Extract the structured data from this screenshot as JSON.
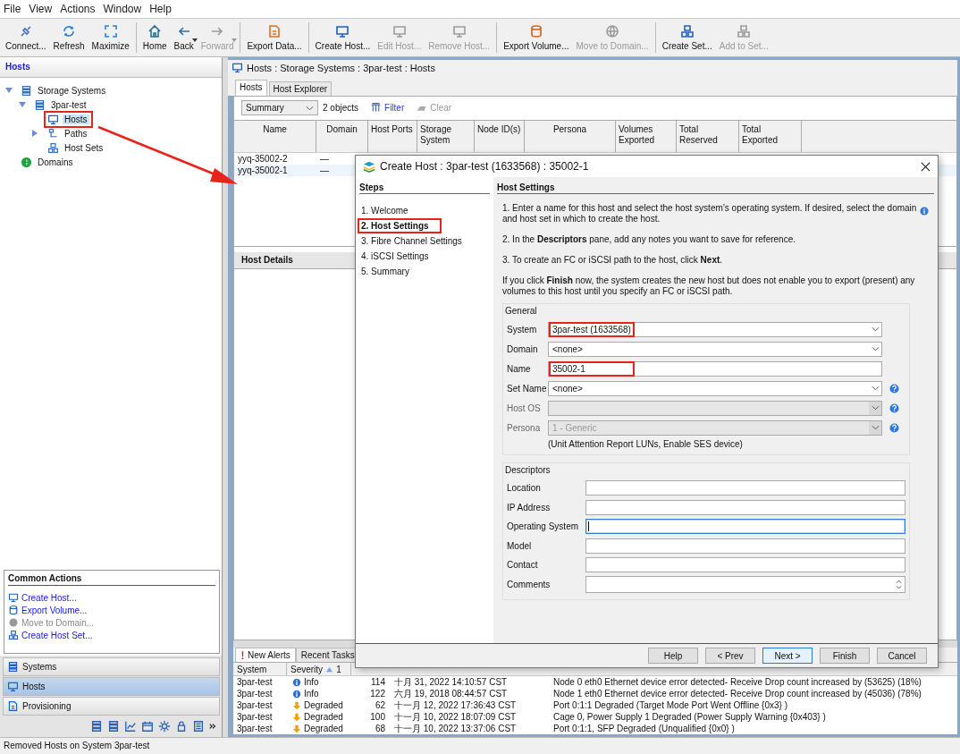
{
  "menu": [
    "File",
    "View",
    "Actions",
    "Window",
    "Help"
  ],
  "toolbar": [
    [
      {
        "label": "Connect...",
        "disabled": false,
        "dropdown": false
      },
      {
        "label": "Refresh",
        "disabled": false,
        "dropdown": false
      },
      {
        "label": "Maximize",
        "disabled": false,
        "dropdown": false
      }
    ],
    [
      {
        "label": "Home",
        "disabled": false,
        "dropdown": false
      },
      {
        "label": "Back",
        "disabled": false,
        "dropdown": true
      },
      {
        "label": "Forward",
        "disabled": true,
        "dropdown": true
      }
    ],
    [
      {
        "label": "Export Data...",
        "disabled": false,
        "dropdown": false
      }
    ],
    [
      {
        "label": "Create Host...",
        "disabled": false,
        "dropdown": false
      },
      {
        "label": "Edit Host...",
        "disabled": true,
        "dropdown": false
      },
      {
        "label": "Remove Host...",
        "disabled": true,
        "dropdown": false
      }
    ],
    [
      {
        "label": "Export Volume...",
        "disabled": false,
        "dropdown": false
      },
      {
        "label": "Move to Domain...",
        "disabled": true,
        "dropdown": false
      }
    ],
    [
      {
        "label": "Create Set...",
        "disabled": false,
        "dropdown": false
      },
      {
        "label": "Add to Set...",
        "disabled": true,
        "dropdown": false
      }
    ]
  ],
  "tree": {
    "header": "Hosts",
    "items": [
      {
        "label": "Storage Systems",
        "selected": false,
        "expanded": true,
        "children": [
          {
            "label": "3par-test",
            "selected": false,
            "expanded": true,
            "children": [
              {
                "label": "Hosts",
                "selected": true,
                "highlighted": true
              },
              {
                "label": "Paths",
                "selected": false,
                "expanded": false
              },
              {
                "label": "Host Sets",
                "selected": false
              }
            ]
          }
        ]
      },
      {
        "label": "Domains",
        "selected": false
      }
    ]
  },
  "common_actions": {
    "title": "Common Actions",
    "items": [
      {
        "label": "Create Host...",
        "disabled": false
      },
      {
        "label": "Export Volume...",
        "disabled": false
      },
      {
        "label": "Move to Domain...",
        "disabled": true
      },
      {
        "label": "Create Host Set...",
        "disabled": false
      }
    ]
  },
  "nav": [
    {
      "label": "Systems",
      "selected": false
    },
    {
      "label": "Hosts",
      "selected": true
    },
    {
      "label": "Provisioning",
      "selected": false
    }
  ],
  "panel": {
    "title": "Hosts : Storage Systems : 3par-test : Hosts",
    "tabs": [
      {
        "label": "Hosts",
        "selected": true
      },
      {
        "label": "Host Explorer",
        "selected": false
      }
    ],
    "view": "Summary",
    "count": "2 objects",
    "filter": "Filter",
    "clear": {
      "label": "Clear",
      "disabled": true
    },
    "columns": [
      "Name",
      "Domain",
      "Host Ports",
      "Storage System",
      "Node ID(s)",
      "Persona",
      "Volumes Exported",
      "Total Reserved",
      "Total Exported"
    ],
    "rows": [
      {
        "name": "yyq-35002-2",
        "domain": "—",
        "selected": false
      },
      {
        "name": "yyq-35002-1",
        "domain": "—",
        "selected": true
      }
    ],
    "details": "Host Details"
  },
  "alerts": {
    "tabs": [
      {
        "label": "New Alerts",
        "selected": true
      },
      {
        "label": "Recent Tasks",
        "selected": false
      }
    ],
    "columns": [
      "System",
      "Severity"
    ],
    "sort_order": "1",
    "rows": [
      {
        "system": "3par-test",
        "kind": "info",
        "severity": "Info",
        "id": "114",
        "time": "十月 31, 2022 14:10:57 CST",
        "message": "Node 0 eth0 Ethernet device error detected- Receive Drop count increased by (53625) (18%)"
      },
      {
        "system": "3par-test",
        "kind": "info",
        "severity": "Info",
        "id": "122",
        "time": "六月 19, 2018 08:44:57 CST",
        "message": "Node 1 eth0 Ethernet device error detected- Receive Drop count increased by (45036) (78%)"
      },
      {
        "system": "3par-test",
        "kind": "degraded",
        "severity": "Degraded",
        "id": "62",
        "time": "十一月 12, 2022 17:36:43 CST",
        "message": "Port 0:1:1 Degraded (Target Mode Port Went Offline {0x3} )"
      },
      {
        "system": "3par-test",
        "kind": "degraded",
        "severity": "Degraded",
        "id": "100",
        "time": "十一月 10, 2022 18:07:09 CST",
        "message": "Cage 0, Power Supply 1 Degraded (Power Supply Warning {0x403} )"
      },
      {
        "system": "3par-test",
        "kind": "degraded",
        "severity": "Degraded",
        "id": "68",
        "time": "十一月 10, 2022 13:37:06 CST",
        "message": "Port 0:1:1, SFP Degraded (Unqualified {0x0} )"
      }
    ]
  },
  "status_bar": "Removed Hosts on System 3par-test",
  "dialog": {
    "title": "Create Host : 3par-test (1633568) : 35002-1",
    "steps_heading": "Steps",
    "steps": [
      {
        "label": "1. Welcome",
        "selected": false,
        "highlighted": false
      },
      {
        "label": "2. Host Settings",
        "selected": true,
        "highlighted": true
      },
      {
        "label": "3. Fibre Channel Settings",
        "selected": false,
        "highlighted": false
      },
      {
        "label": "4. iSCSI Settings",
        "selected": false,
        "highlighted": false
      },
      {
        "label": "5. Summary",
        "selected": false,
        "highlighted": false
      }
    ],
    "heading": "Host Settings",
    "paragraphs": [
      "1. Enter a name for this host and select the host system’s operating system. If desired, select the domain and host set in which to create the host.",
      "2. In the **Descriptors** pane, add any notes you want to save for reference.",
      "3. To create an FC or iSCSI path to the host, click **Next**.",
      "If you click **Finish** now, the system creates the new host but does not enable you to export (present) any volumes to this host until you specify an FC or iSCSI path."
    ],
    "general": {
      "legend": "General",
      "fields": [
        {
          "label": "System",
          "kind": "select",
          "value": "3par-test (1633568)",
          "help": false,
          "disabled": false,
          "highlighted": true
        },
        {
          "label": "Domain",
          "kind": "select",
          "value": "<none>",
          "help": false,
          "disabled": false,
          "highlighted": false
        },
        {
          "label": "Name",
          "kind": "text",
          "value": "35002-1",
          "help": false,
          "disabled": false,
          "highlighted": true
        },
        {
          "label": "Set Name",
          "kind": "select",
          "value": "<none>",
          "help": true,
          "disabled": false,
          "highlighted": false
        },
        {
          "label": "Host OS",
          "kind": "select",
          "help": true,
          "disabled": true,
          "highlighted": false
        },
        {
          "label": "Persona",
          "kind": "select",
          "value": "1 - Generic",
          "help": true,
          "disabled": true,
          "highlighted": false
        }
      ],
      "note": "(Unit Attention Report LUNs, Enable SES device)"
    },
    "descriptors": {
      "legend": "Descriptors",
      "fields": [
        {
          "label": "Location",
          "kind": "text",
          "focused": false
        },
        {
          "label": "IP Address",
          "kind": "text",
          "focused": false
        },
        {
          "label": "Operating System",
          "kind": "text",
          "focused": true
        },
        {
          "label": "Model",
          "kind": "text",
          "focused": false
        },
        {
          "label": "Contact",
          "kind": "text",
          "focused": false
        },
        {
          "label": "Comments",
          "kind": "textarea",
          "focused": false
        }
      ]
    },
    "buttons": [
      {
        "label": "Help",
        "default": false
      },
      {
        "label": "< Prev",
        "default": false
      },
      {
        "label": "Next >",
        "default": true
      },
      {
        "label": "Finish",
        "default": false
      },
      {
        "label": "Cancel",
        "default": false
      }
    ]
  }
}
